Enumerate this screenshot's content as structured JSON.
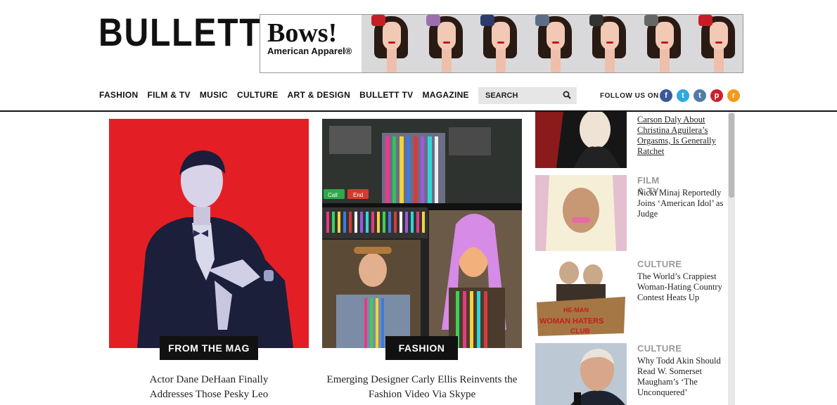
{
  "header": {
    "logo": "BULLETT",
    "ad": {
      "title": "Bows!",
      "subtitle": "American Apparel®"
    }
  },
  "nav": {
    "items": [
      {
        "label": "FASHION"
      },
      {
        "label": "FILM & TV"
      },
      {
        "label": "MUSIC"
      },
      {
        "label": "CULTURE"
      },
      {
        "label": "ART & DESIGN"
      },
      {
        "label": "BULLETT TV"
      },
      {
        "label": "MAGAZINE"
      }
    ]
  },
  "search": {
    "placeholder": "SEARCH"
  },
  "follow": {
    "label": "FOLLOW US ON"
  },
  "social": {
    "facebook": "f",
    "twitter": "t",
    "tumblr": "t",
    "pinterest": "p",
    "rss": "r"
  },
  "features": [
    {
      "tag": "FROM THE MAG",
      "headline": "Actor Dane DeHaan Finally Addresses Those Pesky Leo"
    },
    {
      "tag": "FASHION",
      "headline": "Emerging Designer Carly Ellis Reinvents the Fashion Video Via Skype"
    }
  ],
  "sidebar": [
    {
      "category": "",
      "title": "Carson Daly About Christina Aguilera’s Orgasms, Is Generally Ratchet"
    },
    {
      "category": "FILM & TV",
      "title": "Nicki Minaj Reportedly Joins ‘American Idol’ as Judge"
    },
    {
      "category": "CULTURE",
      "title": "The World’s Crappiest Woman-Hating Country Contest Heats Up"
    },
    {
      "category": "CULTURE",
      "title": "Why Todd Akin Should Read W. Somerset Maugham’s ‘The Unconquered’"
    }
  ],
  "images": {
    "sign": "HE-MAN WOMAN HATERS CLUB",
    "call": "Call",
    "end": "End"
  },
  "colors": {
    "accent_red": "#e31f25",
    "rule": "#111111",
    "category_gray": "#9a9a9a"
  }
}
